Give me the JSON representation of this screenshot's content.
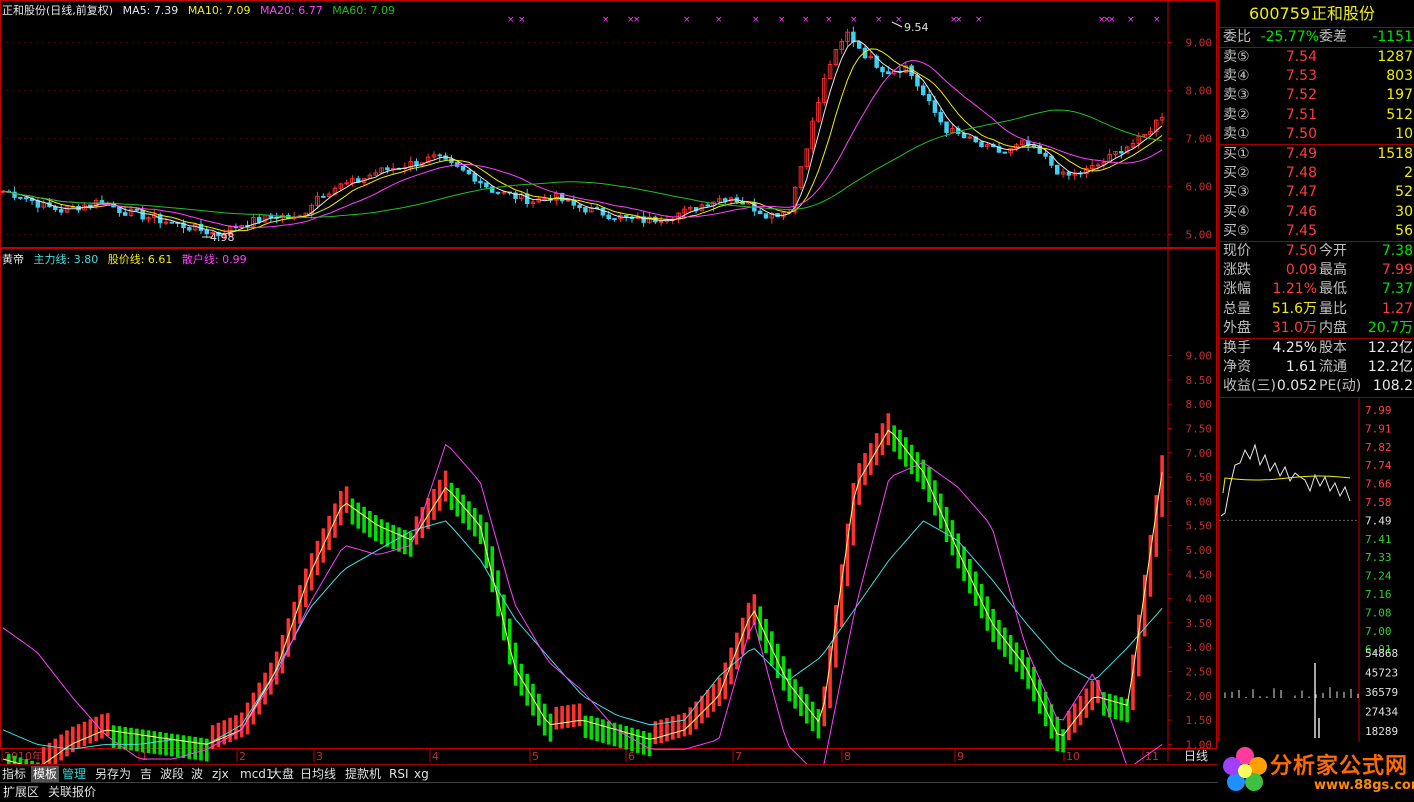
{
  "colors": {
    "up": "#ff3030",
    "down": "#00e000",
    "ma5": "#e8e8e8",
    "ma10": "#f0f000",
    "ma20": "#ff40ff",
    "ma60": "#20c020",
    "main_line": "#40e0e0",
    "price_line": "#ffff80",
    "retail_line": "#ff40ff",
    "grid": "#800000",
    "border": "#c00000"
  },
  "header": {
    "title": "正和股份(日线,前复权)",
    "ma5": "MA5: 7.39",
    "ma10": "MA10: 7.09",
    "ma20": "MA20: 6.77",
    "ma60": "MA60: 7.09"
  },
  "indicator_header": {
    "name": "黄帝",
    "main": "主力线: 3.80",
    "price": "股价线: 6.61",
    "retail": "散户线: 0.99"
  },
  "price_axis": [
    "9.00",
    "8.00",
    "7.00",
    "6.00",
    "5.00"
  ],
  "ind_axis": [
    "9.00",
    "8.50",
    "8.00",
    "7.50",
    "7.00",
    "6.50",
    "6.00",
    "5.50",
    "5.00",
    "4.50",
    "4.00",
    "3.50",
    "3.00",
    "2.50",
    "2.00",
    "1.50",
    "1.00"
  ],
  "annotations": {
    "high": "9.54",
    "low": "4.98"
  },
  "months": [
    "2010年",
    "1",
    "2",
    "3",
    "4",
    "5",
    "6",
    "7",
    "8",
    "9",
    "10",
    "11"
  ],
  "right": {
    "code": "600759",
    "name": "正和股份",
    "webi_label": "委比",
    "webi": "-25.77%",
    "weicha_label": "委差",
    "weicha": "-1151",
    "sells": [
      {
        "label": "卖⑤",
        "price": "7.54",
        "vol": "1287"
      },
      {
        "label": "卖④",
        "price": "7.53",
        "vol": "803"
      },
      {
        "label": "卖③",
        "price": "7.52",
        "vol": "197"
      },
      {
        "label": "卖②",
        "price": "7.51",
        "vol": "512"
      },
      {
        "label": "卖①",
        "price": "7.50",
        "vol": "10"
      }
    ],
    "buys": [
      {
        "label": "买①",
        "price": "7.49",
        "vol": "1518"
      },
      {
        "label": "买②",
        "price": "7.48",
        "vol": "2"
      },
      {
        "label": "买③",
        "price": "7.47",
        "vol": "52"
      },
      {
        "label": "买④",
        "price": "7.46",
        "vol": "30"
      },
      {
        "label": "买⑤",
        "price": "7.45",
        "vol": "56"
      }
    ],
    "stats1": [
      {
        "l1": "现价",
        "v1": "7.50",
        "l2": "今开",
        "v2": "7.38",
        "c1": "red",
        "c2": "green"
      },
      {
        "l1": "涨跌",
        "v1": "0.09",
        "l2": "最高",
        "v2": "7.99",
        "c1": "red",
        "c2": "red"
      },
      {
        "l1": "涨幅",
        "v1": "1.21%",
        "l2": "最低",
        "v2": "7.37",
        "c1": "red",
        "c2": "green"
      },
      {
        "l1": "总量",
        "v1": "51.6万",
        "l2": "量比",
        "v2": "1.27",
        "c1": "yel",
        "c2": "red"
      },
      {
        "l1": "外盘",
        "v1": "31.0万",
        "l2": "内盘",
        "v2": "20.7万",
        "c1": "red",
        "c2": "green"
      }
    ],
    "stats2": [
      {
        "l1": "换手",
        "v1": "4.25%",
        "l2": "股本",
        "v2": "12.2亿",
        "c1": "wh",
        "c2": "wh"
      },
      {
        "l1": "净资",
        "v1": "1.61",
        "l2": "流通",
        "v2": "12.2亿",
        "c1": "wh",
        "c2": "wh"
      },
      {
        "l1": "收益(三)",
        "v1": "0.052",
        "l2": "PE(动)",
        "v2": "108.2",
        "c1": "wh",
        "c2": "wh"
      }
    ],
    "mini_price_axis": [
      "7.99",
      "7.91",
      "7.82",
      "7.74",
      "7.66",
      "7.58",
      "7.49",
      "7.41",
      "7.33",
      "7.24",
      "7.16",
      "7.08",
      "7.00",
      "6.91"
    ],
    "mini_vol_axis": [
      "54868",
      "45723",
      "36579",
      "27434",
      "18289"
    ],
    "period_label": "日线"
  },
  "toolbar": {
    "items": [
      "指标",
      "模板",
      "管理",
      "另存为",
      "吉",
      "波段",
      "波",
      "zjx",
      "mcd1",
      "大盘",
      "日均线",
      "提款机",
      "RSI",
      "xg"
    ]
  },
  "status": {
    "left1": "扩展区",
    "left2": "关联报价"
  },
  "logo": {
    "text": "分析家公式网",
    "url": "www.88gs.com"
  },
  "chart_data": [
    {
      "type": "candlestick",
      "title": "正和股份(日线,前复权)",
      "ylim": [
        4.8,
        9.7
      ],
      "x_labels": [
        "2010年",
        "1",
        "2",
        "3",
        "4",
        "5",
        "6",
        "7",
        "8",
        "9",
        "10",
        "11"
      ],
      "close_path": [
        5.9,
        5.8,
        5.6,
        5.5,
        5.6,
        5.7,
        5.5,
        5.4,
        5.3,
        5.2,
        5.1,
        5.0,
        5.2,
        5.3,
        5.4,
        5.3,
        5.8,
        6.0,
        6.1,
        6.3,
        6.4,
        6.5,
        6.6,
        6.4,
        6.2,
        5.9,
        5.8,
        5.7,
        5.8,
        5.6,
        5.5,
        5.4,
        5.3,
        5.3,
        5.4,
        5.5,
        5.7,
        5.8,
        5.6,
        5.4,
        5.5,
        7.0,
        8.5,
        9.2,
        8.7,
        8.4,
        8.5,
        7.8,
        7.2,
        7.0,
        6.8,
        6.7,
        6.9,
        6.6,
        6.2,
        6.3,
        6.5,
        6.8,
        7.0,
        7.5
      ],
      "ma5_last": 7.39,
      "ma10_last": 7.09,
      "ma20_last": 6.77,
      "ma60_last": 7.09,
      "high_label": 9.54,
      "low_label": 4.98
    },
    {
      "type": "line",
      "title": "黄帝",
      "ylim": [
        0,
        10
      ],
      "series": [
        {
          "name": "主力线",
          "last": 3.8
        },
        {
          "name": "股价线",
          "last": 6.61
        },
        {
          "name": "散户线",
          "last": 0.99
        }
      ]
    }
  ]
}
